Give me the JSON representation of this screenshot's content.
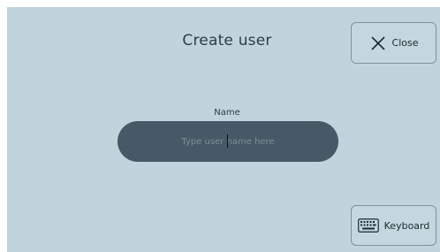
{
  "dialog": {
    "title": "Create user"
  },
  "close_button": {
    "label": "Close",
    "icon": "close-icon"
  },
  "name_field": {
    "label": "Name",
    "placeholder": "Type user name here",
    "value": ""
  },
  "keyboard_button": {
    "label": "Keyboard",
    "icon": "keyboard-icon"
  },
  "colors": {
    "background": "#bfd4dc",
    "input_fill": "#455a66",
    "button_border": "#7f939b",
    "text": "#2f3d45"
  }
}
